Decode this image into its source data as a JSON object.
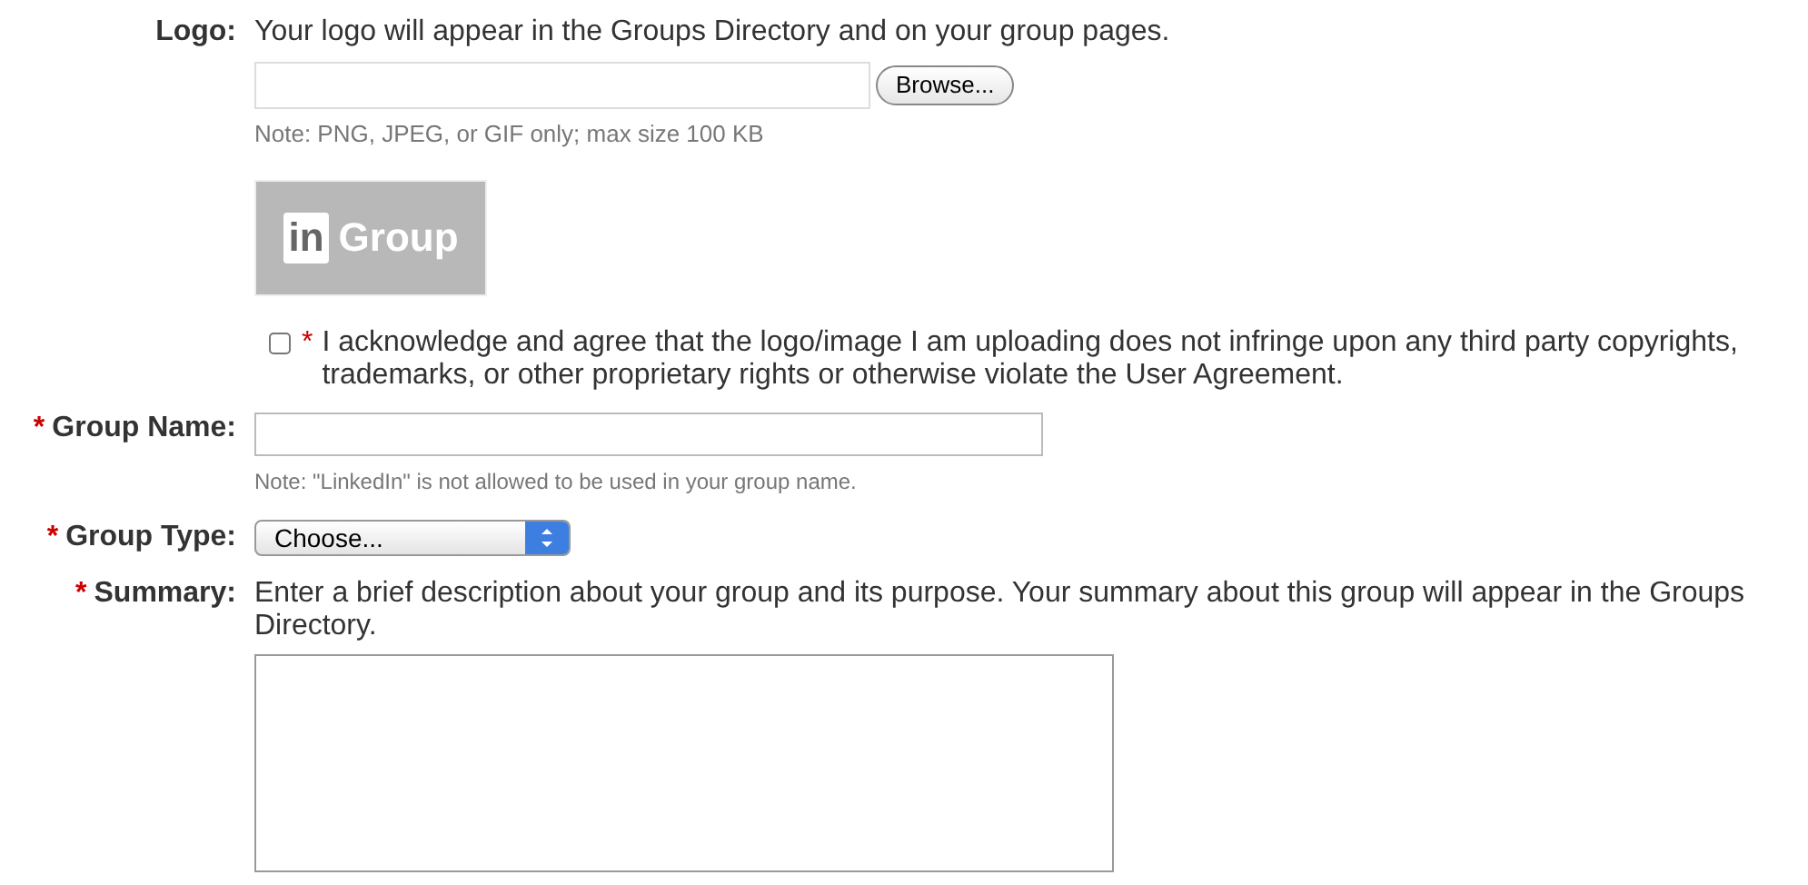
{
  "required_marker": "*",
  "logo": {
    "label": "Logo:",
    "required": false,
    "description": "Your logo will appear in the Groups Directory and on your group pages.",
    "browse_button": "Browse...",
    "note": "Note: PNG, JPEG, or GIF only; max size 100 KB",
    "preview": {
      "badge": "in",
      "text": "Group"
    }
  },
  "agreement": {
    "checked": false,
    "required": true,
    "text": "I acknowledge and agree that the logo/image I am uploading does not infringe upon any third party copyrights, trademarks, or other proprietary rights or otherwise violate the User Agreement."
  },
  "group_name": {
    "label": "Group Name:",
    "required": true,
    "note": "Note: \"LinkedIn\" is not allowed to be used in your group name."
  },
  "group_type": {
    "label": "Group Type:",
    "required": true,
    "value": "Choose..."
  },
  "summary": {
    "label": "Summary:",
    "required": true,
    "description": "Enter a brief description about your group and its purpose. Your summary about this group will appear in the Groups Directory."
  }
}
